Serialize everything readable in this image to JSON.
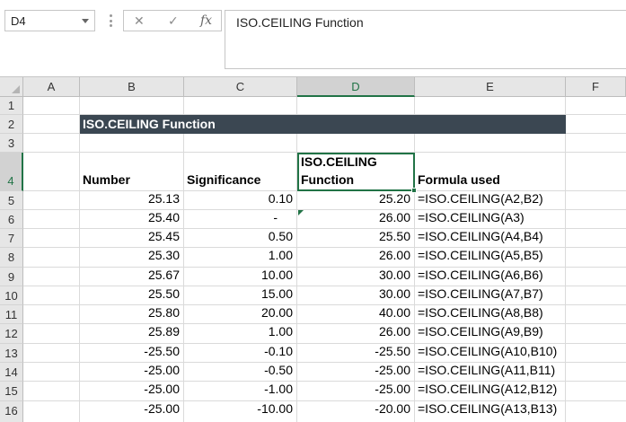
{
  "name_box": "D4",
  "formula_bar": {
    "cancel_icon": "✕",
    "enter_icon": "✓",
    "fx_icon": "fx",
    "content": "ISO.CEILING Function"
  },
  "columns": [
    "A",
    "B",
    "C",
    "D",
    "E",
    "F"
  ],
  "rows": [
    "1",
    "2",
    "3",
    "4",
    "5",
    "6",
    "7",
    "8",
    "9",
    "10",
    "11",
    "12",
    "13",
    "14",
    "15",
    "16"
  ],
  "title": "ISO.CEILING Function",
  "headers": {
    "number": "Number",
    "significance": "Significance",
    "function_line1": "ISO.CEILING",
    "function_line2": "Function",
    "formula_used": "Formula used"
  },
  "table": [
    {
      "number": "25.13",
      "significance": "0.10",
      "result": "25.20",
      "formula": "=ISO.CEILING(A2,B2)"
    },
    {
      "number": "25.40",
      "significance": "-",
      "result": "26.00",
      "formula": "=ISO.CEILING(A3)"
    },
    {
      "number": "25.45",
      "significance": "0.50",
      "result": "25.50",
      "formula": "=ISO.CEILING(A4,B4)"
    },
    {
      "number": "25.30",
      "significance": "1.00",
      "result": "26.00",
      "formula": "=ISO.CEILING(A5,B5)"
    },
    {
      "number": "25.67",
      "significance": "10.00",
      "result": "30.00",
      "formula": "=ISO.CEILING(A6,B6)"
    },
    {
      "number": "25.50",
      "significance": "15.00",
      "result": "30.00",
      "formula": "=ISO.CEILING(A7,B7)"
    },
    {
      "number": "25.80",
      "significance": "20.00",
      "result": "40.00",
      "formula": "=ISO.CEILING(A8,B8)"
    },
    {
      "number": "25.89",
      "significance": "1.00",
      "result": "26.00",
      "formula": "=ISO.CEILING(A9,B9)"
    },
    {
      "number": "-25.50",
      "significance": "-0.10",
      "result": "-25.50",
      "formula": "=ISO.CEILING(A10,B10)"
    },
    {
      "number": "-25.00",
      "significance": "-0.50",
      "result": "-25.00",
      "formula": "=ISO.CEILING(A11,B11)"
    },
    {
      "number": "-25.00",
      "significance": "-1.00",
      "result": "-25.00",
      "formula": "=ISO.CEILING(A12,B12)"
    },
    {
      "number": "-25.00",
      "significance": "-10.00",
      "result": "-20.00",
      "formula": "=ISO.CEILING(A13,B13)"
    }
  ],
  "colors": {
    "accent": "#217346",
    "title_fill": "#3b4752",
    "header_fill": "#e6e6e6"
  }
}
